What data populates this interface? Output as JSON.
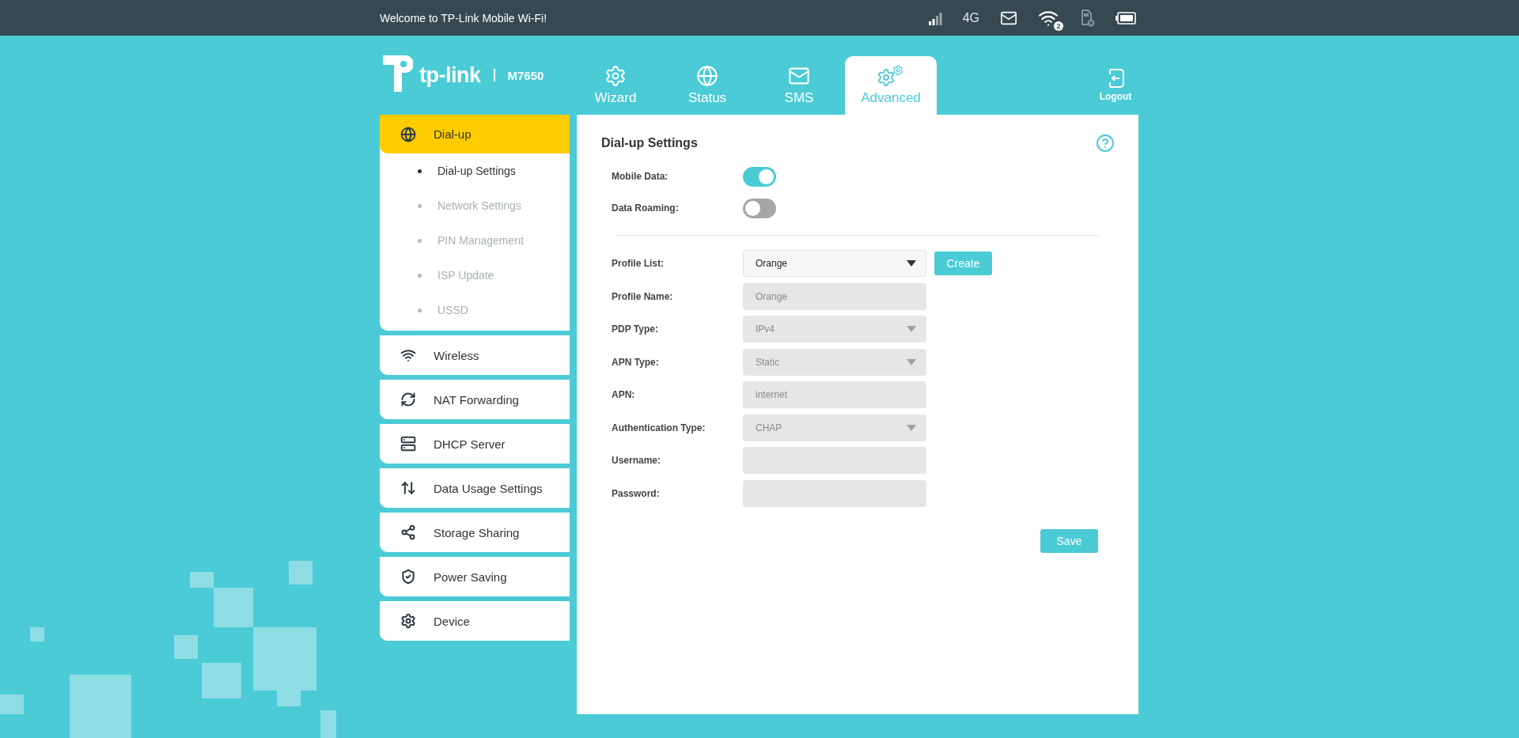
{
  "top_bar": {
    "welcome": "Welcome to TP-Link Mobile Wi-Fi!",
    "network_type": "4G",
    "wifi_clients": "2"
  },
  "brand": {
    "logo_text": "tp-link",
    "model": "M7650"
  },
  "tabs": [
    {
      "label": "Wizard",
      "selected": false
    },
    {
      "label": "Status",
      "selected": false
    },
    {
      "label": "SMS",
      "selected": false
    },
    {
      "label": "Advanced",
      "selected": true
    }
  ],
  "logout": "Logout",
  "sidebar": {
    "items": [
      {
        "label": "Dial-up",
        "selected": true,
        "children": [
          {
            "label": "Dial-up Settings",
            "selected": true
          },
          {
            "label": "Network Settings",
            "selected": false
          },
          {
            "label": "PIN Management",
            "selected": false
          },
          {
            "label": "ISP Update",
            "selected": false
          },
          {
            "label": "USSD",
            "selected": false
          }
        ]
      },
      {
        "label": "Wireless",
        "selected": false
      },
      {
        "label": "NAT Forwarding",
        "selected": false
      },
      {
        "label": "DHCP Server",
        "selected": false
      },
      {
        "label": "Data Usage Settings",
        "selected": false
      },
      {
        "label": "Storage Sharing",
        "selected": false
      },
      {
        "label": "Power Saving",
        "selected": false
      },
      {
        "label": "Device",
        "selected": false
      }
    ]
  },
  "panel": {
    "title": "Dial-up Settings",
    "toggles": [
      {
        "label": "Mobile Data:",
        "on": true
      },
      {
        "label": "Data Roaming:",
        "on": false
      }
    ],
    "fields": [
      {
        "label": "Profile List:",
        "kind": "select",
        "value": "Orange",
        "disabled": false,
        "button": "Create"
      },
      {
        "label": "Profile Name:",
        "kind": "input",
        "value": "Orange",
        "disabled": true
      },
      {
        "label": "PDP Type:",
        "kind": "select",
        "value": "IPv4",
        "disabled": true
      },
      {
        "label": "APN Type:",
        "kind": "select",
        "value": "Static",
        "disabled": true
      },
      {
        "label": "APN:",
        "kind": "input",
        "value": "internet",
        "disabled": true
      },
      {
        "label": "Authentication Type:",
        "kind": "select",
        "value": "CHAP",
        "disabled": true
      },
      {
        "label": "Username:",
        "kind": "input",
        "disabled": true
      },
      {
        "label": "Password:",
        "kind": "input",
        "disabled": true
      }
    ],
    "save": "Save"
  }
}
